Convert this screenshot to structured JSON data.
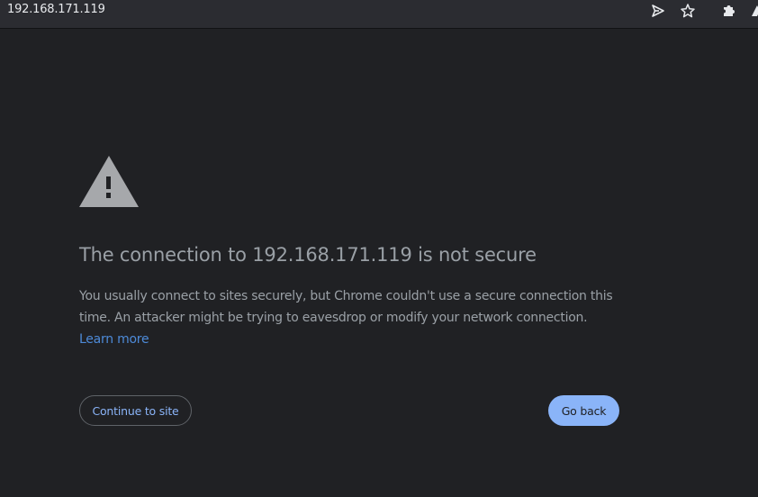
{
  "browser": {
    "url": "192.168.171.119"
  },
  "toolbar_icons": [
    "send-icon",
    "star-icon",
    "extensions-icon",
    "profile-icon"
  ],
  "interstitial": {
    "title": "The connection to 192.168.171.119 is not secure",
    "body": "You usually connect to sites securely, but Chrome couldn't use a secure connection this time. An attacker might be trying to eavesdrop or modify your network connection. ",
    "learn_more": "Learn more",
    "continue_label": "Continue to site",
    "back_label": "Go back"
  },
  "colors": {
    "background": "#202124",
    "toolbar": "#2b2c31",
    "text": "#9aa0a6",
    "link": "#4d8ad8",
    "primary_button": "#8ab4f8"
  }
}
